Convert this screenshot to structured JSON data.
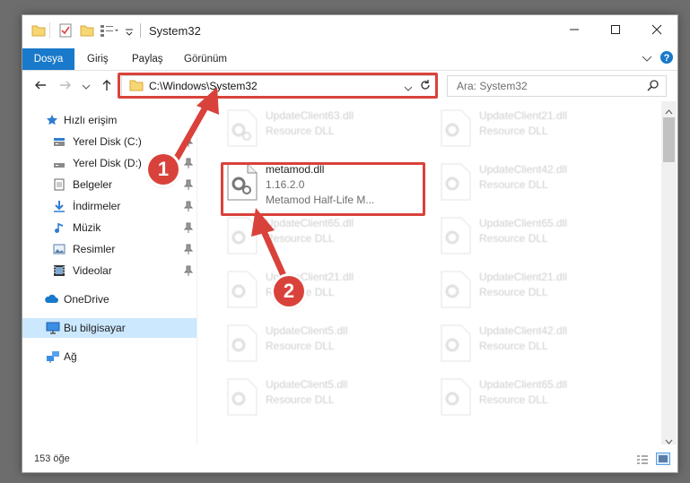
{
  "window": {
    "title": "System32",
    "controls": [
      "minimize-icon",
      "maximize-icon",
      "close-icon"
    ]
  },
  "ribbon": {
    "tabs": [
      "Dosya",
      "Giriş",
      "Paylaş",
      "Görünüm"
    ]
  },
  "navigation": {
    "address": "C:\\Windows\\System32",
    "search_placeholder": "Ara: System32"
  },
  "sidebar": {
    "items": [
      {
        "label": "Hızlı erişim",
        "icon": "star-icon"
      },
      {
        "label": "Yerel Disk (C:)",
        "icon": "drive-icon",
        "pinned": true
      },
      {
        "label": "Yerel Disk (D:)",
        "icon": "drive-icon",
        "pinned": true
      },
      {
        "label": "Belgeler",
        "icon": "documents-icon",
        "pinned": true
      },
      {
        "label": "İndirmeler",
        "icon": "download-icon",
        "pinned": true
      },
      {
        "label": "Müzik",
        "icon": "music-icon",
        "pinned": true
      },
      {
        "label": "Resimler",
        "icon": "pictures-icon",
        "pinned": true
      },
      {
        "label": "Videolar",
        "icon": "videos-icon",
        "pinned": true
      },
      {
        "label": "OneDrive",
        "icon": "cloud-icon"
      },
      {
        "label": "Bu bilgisayar",
        "icon": "computer-icon",
        "selected": true
      },
      {
        "label": "Ağ",
        "icon": "network-icon"
      }
    ]
  },
  "files": {
    "highlighted": {
      "name": "metamod.dll",
      "version": "1.16.2.0",
      "description": "Metamod Half-Life M..."
    },
    "left_column": [
      {
        "name": "UpdateClient63.dll",
        "type": "Resource DLL"
      },
      {
        "name": "UpdateClient65.dll",
        "type": "Resource DLL"
      },
      {
        "name": "UpdateClient21.dll",
        "type": "Resource DLL"
      },
      {
        "name": "UpdateClient5.dll",
        "type": "Resource DLL"
      },
      {
        "name": "UpdateClient5.dll",
        "type": "Resource DLL"
      }
    ],
    "right_column": [
      {
        "name": "UpdateClient21.dll",
        "type": "Resource DLL"
      },
      {
        "name": "UpdateClient42.dll",
        "type": "Resource DLL"
      },
      {
        "name": "UpdateClient65.dll",
        "type": "Resource DLL"
      },
      {
        "name": "UpdateClient21.dll",
        "type": "Resource DLL"
      },
      {
        "name": "UpdateClient21.dll",
        "type": "Resource DLL"
      },
      {
        "name": "UpdateClient42.dll",
        "type": "Resource DLL"
      },
      {
        "name": "UpdateClient65.dll",
        "type": "Resource DLL"
      }
    ]
  },
  "status": {
    "item_count": "153 öğe"
  },
  "annotations": {
    "step1": "1",
    "step2": "2",
    "accent_color": "#d9423b"
  },
  "colors": {
    "file_tab": "#1979ca",
    "selection": "#cce8ff"
  }
}
